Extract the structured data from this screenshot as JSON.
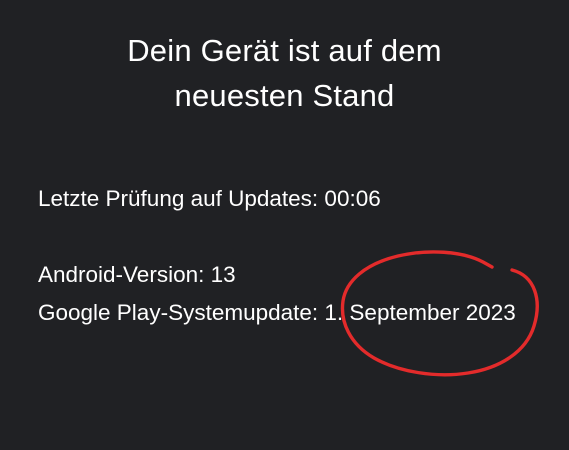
{
  "status": {
    "title_line1": "Dein Gerät ist auf dem",
    "title_line2": "neuesten Stand"
  },
  "details": {
    "last_check": "Letzte Prüfung auf Updates: 00:06",
    "android_version": "Android-Version: 13",
    "play_system_update": "Google Play-Systemupdate: 1. September 2023"
  },
  "colors": {
    "background": "#202124",
    "text": "#ffffff",
    "annotation_circle": "#e32b2b"
  },
  "icons": {
    "annotation": "red-hand-drawn-circle"
  }
}
